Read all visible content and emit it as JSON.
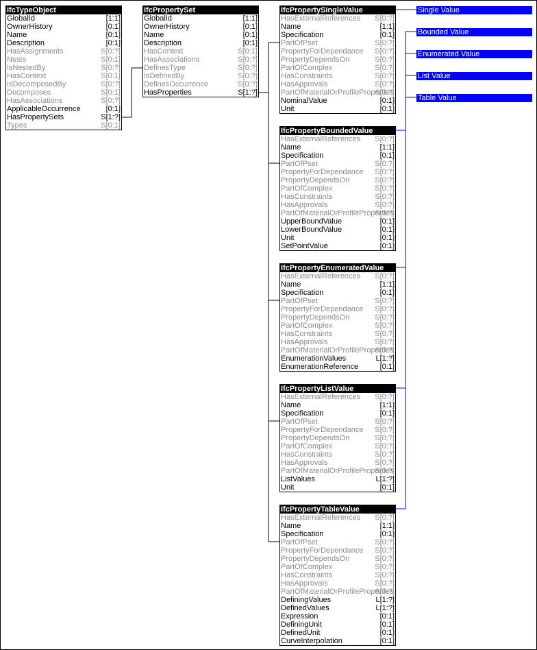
{
  "colors": {
    "link": "#0000ff",
    "label_bg": "#0000ff",
    "active_text": "#000000",
    "inactive_text": "#8c8c8c"
  },
  "boxes": [
    {
      "id": "type-object",
      "title": "IfcTypeObject",
      "rows": [
        [
          "GlobalId",
          "[1:1]",
          1
        ],
        [
          "OwnerHistory",
          "[0:1]",
          1
        ],
        [
          "Name",
          "[0:1]",
          1
        ],
        [
          "Description",
          "[0:1]",
          1
        ],
        [
          "HasAssignments",
          "S[0:?]",
          0
        ],
        [
          "Nests",
          "S[0:1]",
          0
        ],
        [
          "IsNestedBy",
          "S[0:?]",
          0
        ],
        [
          "HasContext",
          "S[0:1]",
          0
        ],
        [
          "IsDecomposedBy",
          "S[0:?]",
          0
        ],
        [
          "Decomposes",
          "S[0:1]",
          0
        ],
        [
          "HasAssociations",
          "S[0:?]",
          0
        ],
        [
          "ApplicableOccurrence",
          "[0:1]",
          1
        ],
        [
          "HasPropertySets",
          "S[1:?]",
          1
        ],
        [
          "Types",
          "S[0:1]",
          0
        ]
      ]
    },
    {
      "id": "property-set",
      "title": "IfcPropertySet",
      "rows": [
        [
          "GlobalId",
          "[1:1]",
          1
        ],
        [
          "OwnerHistory",
          "[0:1]",
          1
        ],
        [
          "Name",
          "[0:1]",
          1
        ],
        [
          "Description",
          "[0:1]",
          1
        ],
        [
          "HasContext",
          "S[0:1]",
          0
        ],
        [
          "HasAssociations",
          "S[0:?]",
          0
        ],
        [
          "DefinesType",
          "S[0:?]",
          0
        ],
        [
          "IsDefinedBy",
          "S[0:?]",
          0
        ],
        [
          "DefinesOccurrence",
          "S[0:?]",
          0
        ],
        [
          "HasProperties",
          "S[1:?]",
          1
        ]
      ]
    },
    {
      "id": "single-value",
      "title": "IfcPropertySingleValue",
      "rows": [
        [
          "HasExternalReferences",
          "S[0:?]",
          0
        ],
        [
          "Name",
          "[1:1]",
          1
        ],
        [
          "Specification",
          "[0:1]",
          1
        ],
        [
          "PartOfPset",
          "S[0:?]",
          0
        ],
        [
          "PropertyForDependance",
          "S[0:?]",
          0
        ],
        [
          "PropertyDependsOn",
          "S[0:?]",
          0
        ],
        [
          "PartOfComplex",
          "S[0:?]",
          0
        ],
        [
          "HasConstraints",
          "S[0:?]",
          0
        ],
        [
          "HasApprovals",
          "S[0:?]",
          0
        ],
        [
          "PartOfMaterialOrProfileProperties",
          "S[0:?]",
          0
        ],
        [
          "NominalValue",
          "[0:1]",
          1
        ],
        [
          "Unit",
          "[0:1]",
          1
        ]
      ]
    },
    {
      "id": "bounded-value",
      "title": "IfcPropertyBoundedValue",
      "rows": [
        [
          "HasExternalReferences",
          "S[0:?]",
          0
        ],
        [
          "Name",
          "[1:1]",
          1
        ],
        [
          "Specification",
          "[0:1]",
          1
        ],
        [
          "PartOfPset",
          "S[0:?]",
          0
        ],
        [
          "PropertyForDependance",
          "S[0:?]",
          0
        ],
        [
          "PropertyDependsOn",
          "S[0:?]",
          0
        ],
        [
          "PartOfComplex",
          "S[0:?]",
          0
        ],
        [
          "HasConstraints",
          "S[0:?]",
          0
        ],
        [
          "HasApprovals",
          "S[0:?]",
          0
        ],
        [
          "PartOfMaterialOrProfileProperties",
          "S[0:?]",
          0
        ],
        [
          "UpperBoundValue",
          "[0:1]",
          1
        ],
        [
          "LowerBoundValue",
          "[0:1]",
          1
        ],
        [
          "Unit",
          "[0:1]",
          1
        ],
        [
          "SetPointValue",
          "[0:1]",
          1
        ]
      ]
    },
    {
      "id": "enumerated-value",
      "title": "IfcPropertyEnumeratedValue",
      "rows": [
        [
          "HasExternalReferences",
          "S[0:?]",
          0
        ],
        [
          "Name",
          "[1:1]",
          1
        ],
        [
          "Specification",
          "[0:1]",
          1
        ],
        [
          "PartOfPset",
          "S[0:?]",
          0
        ],
        [
          "PropertyForDependance",
          "S[0:?]",
          0
        ],
        [
          "PropertyDependsOn",
          "S[0:?]",
          0
        ],
        [
          "PartOfComplex",
          "S[0:?]",
          0
        ],
        [
          "HasConstraints",
          "S[0:?]",
          0
        ],
        [
          "HasApprovals",
          "S[0:?]",
          0
        ],
        [
          "PartOfMaterialOrProfileProperties",
          "S[0:?]",
          0
        ],
        [
          "EnumerationValues",
          "L[1:?]",
          1
        ],
        [
          "EnumerationReference",
          "[0:1]",
          1
        ]
      ]
    },
    {
      "id": "list-value",
      "title": "IfcPropertyListValue",
      "rows": [
        [
          "HasExternalReferences",
          "S[0:?]",
          0
        ],
        [
          "Name",
          "[1:1]",
          1
        ],
        [
          "Specification",
          "[0:1]",
          1
        ],
        [
          "PartOfPset",
          "S[0:?]",
          0
        ],
        [
          "PropertyForDependance",
          "S[0:?]",
          0
        ],
        [
          "PropertyDependsOn",
          "S[0:?]",
          0
        ],
        [
          "PartOfComplex",
          "S[0:?]",
          0
        ],
        [
          "HasConstraints",
          "S[0:?]",
          0
        ],
        [
          "HasApprovals",
          "S[0:?]",
          0
        ],
        [
          "PartOfMaterialOrProfileProperties",
          "S[0:?]",
          0
        ],
        [
          "ListValues",
          "L[1:?]",
          1
        ],
        [
          "Unit",
          "[0:1]",
          1
        ]
      ]
    },
    {
      "id": "table-value",
      "title": "IfcPropertyTableValue",
      "rows": [
        [
          "HasExternalReferences",
          "S[0:?]",
          0
        ],
        [
          "Name",
          "[1:1]",
          1
        ],
        [
          "Specification",
          "[0:1]",
          1
        ],
        [
          "PartOfPset",
          "S[0:?]",
          0
        ],
        [
          "PropertyForDependance",
          "S[0:?]",
          0
        ],
        [
          "PropertyDependsOn",
          "S[0:?]",
          0
        ],
        [
          "PartOfComplex",
          "S[0:?]",
          0
        ],
        [
          "HasConstraints",
          "S[0:?]",
          0
        ],
        [
          "HasApprovals",
          "S[0:?]",
          0
        ],
        [
          "PartOfMaterialOrProfileProperties",
          "S[0:?]",
          0
        ],
        [
          "DefiningValues",
          "L[1:?]",
          1
        ],
        [
          "DefinedValues",
          "L[1:?]",
          1
        ],
        [
          "Expression",
          "[0:1]",
          1
        ],
        [
          "DefiningUnit",
          "[0:1]",
          1
        ],
        [
          "DefinedUnit",
          "[0:1]",
          1
        ],
        [
          "CurveInterpolation",
          "[0:1]",
          1
        ]
      ]
    }
  ],
  "labels": [
    "Single Value",
    "Bounded Value",
    "Enumerated Value",
    "List Value",
    "Table Value"
  ]
}
